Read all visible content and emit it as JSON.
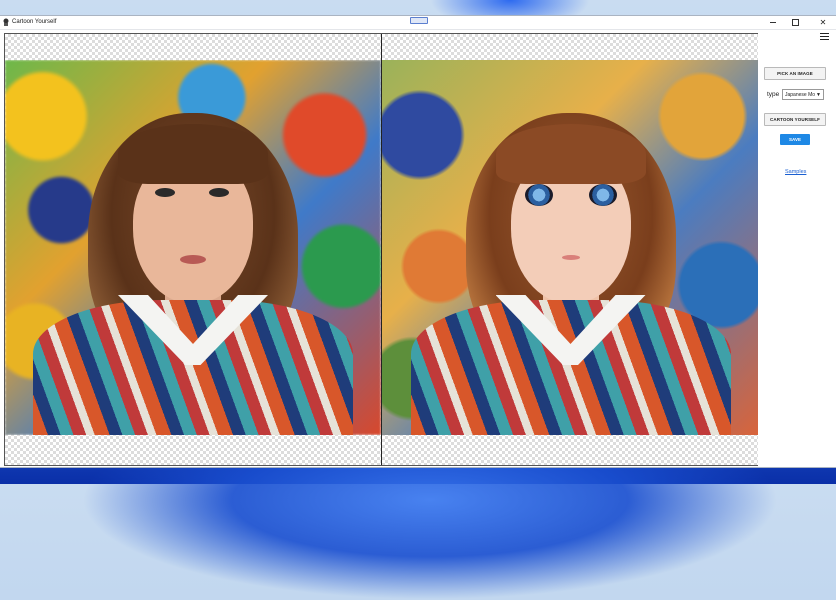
{
  "window": {
    "title": "Cartoon Yourself",
    "controls": {
      "minimize": "minimize-icon",
      "maximize": "maximize-icon",
      "close": "close-icon"
    }
  },
  "canvas": {
    "left_panel": {
      "content": "Original photo: young woman with wavy brown bob haircut, white collar and striped jacket, colorful graffiti background"
    },
    "right_panel": {
      "content": "Anime-style cartoon version of the same portrait"
    }
  },
  "sidebar": {
    "menu_icon": "hamburger-menu-icon",
    "pick_image_label": "PICK AN IMAGE",
    "type_label": "type",
    "type_value": "Japanese Mo",
    "cartoon_button_label": "CARTOON YOURSELF",
    "save_label": "SAVE",
    "samples_link": "Samples"
  },
  "colors": {
    "accent": "#1e88e5",
    "link": "#1a5fd1",
    "window_bg": "#ffffff"
  }
}
